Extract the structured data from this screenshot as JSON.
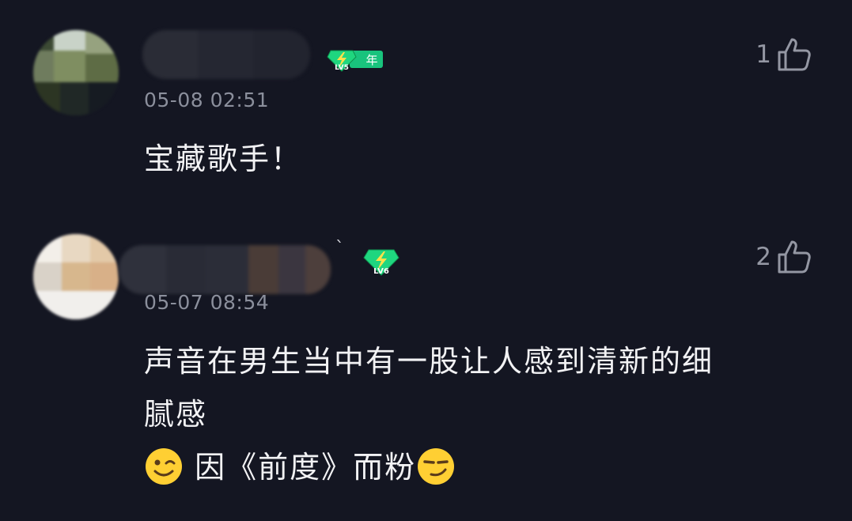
{
  "comments": [
    {
      "level": "LV5",
      "badge_extra": "年",
      "timestamp": "05-08 02:51",
      "like_count": "1",
      "text": "宝藏歌手！"
    },
    {
      "level": "LV6",
      "timestamp": "05-07 08:54",
      "like_count": "2",
      "text_line1": "声音在男生当中有一股让人感到清新的细",
      "text_line2": "腻感",
      "text_line3": " 因《前度》而粉"
    }
  ],
  "icons": {
    "like": "thumbs-up-icon",
    "level_badge": "lightning-gem-icon",
    "emoji1": "wink-emoji-icon",
    "emoji2": "smirk-emoji-icon"
  },
  "colors": {
    "background": "#141622",
    "badge_green": "#19c37d",
    "timestamp": "#8b8f9c",
    "like": "#9497a3"
  }
}
